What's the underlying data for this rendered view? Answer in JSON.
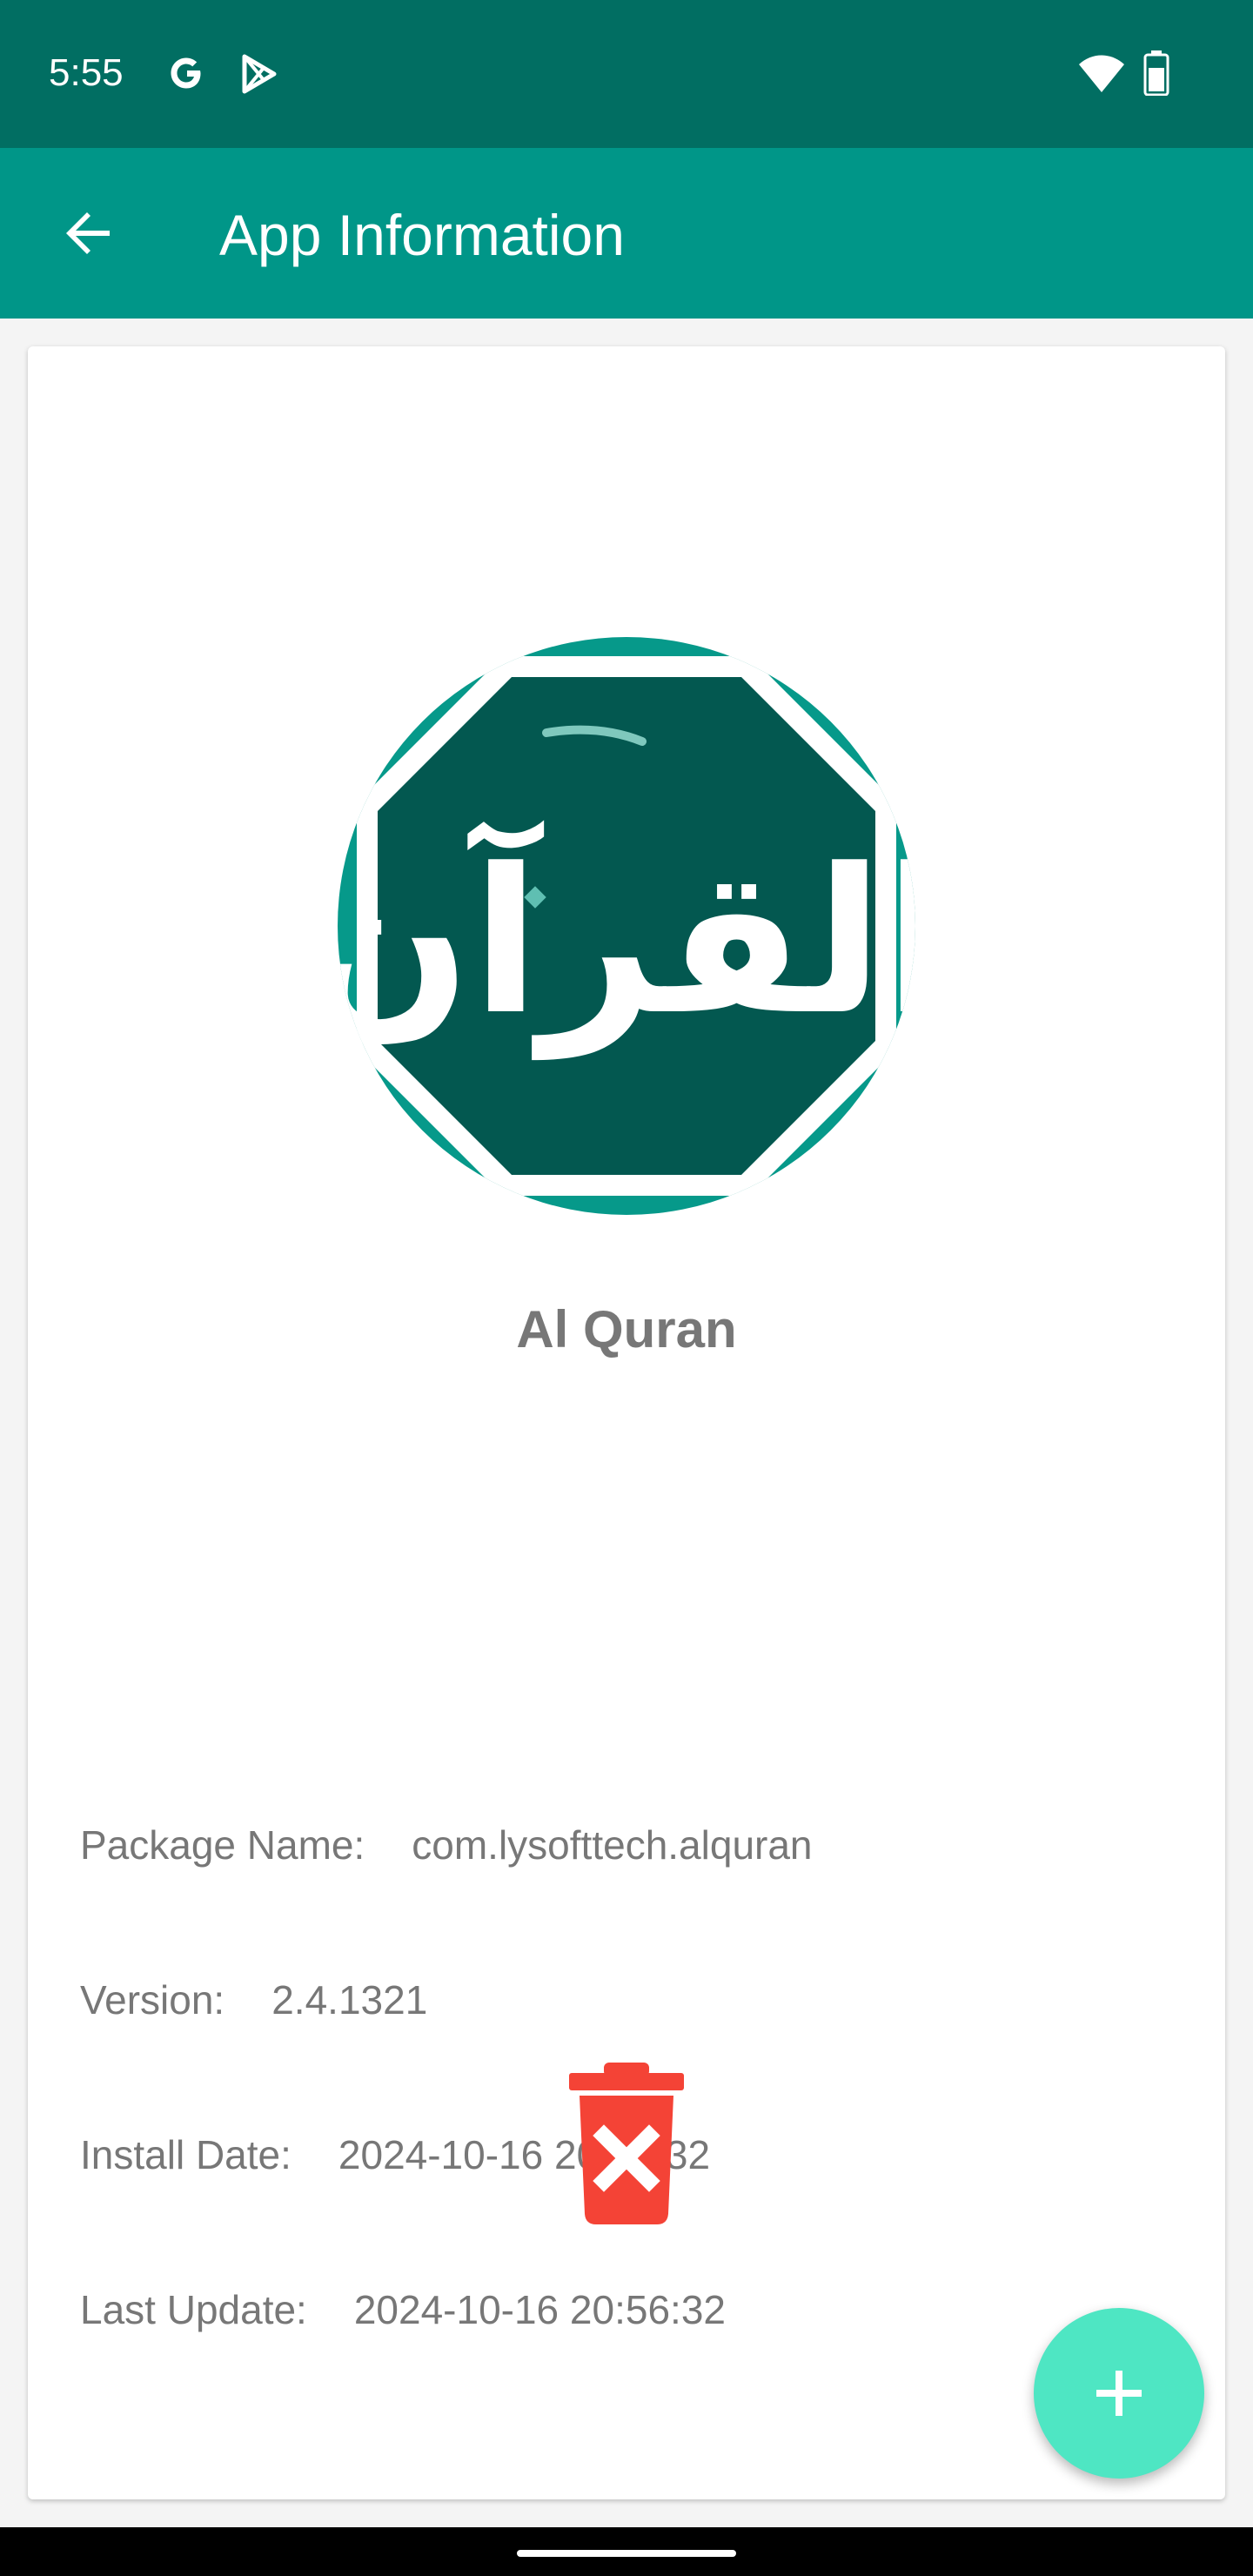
{
  "status_bar": {
    "time": "5:55",
    "left_icons": [
      "google-g-icon",
      "play-store-icon"
    ],
    "right_icons": [
      "wifi-icon",
      "battery-icon"
    ]
  },
  "app_bar": {
    "title": "App Information",
    "back_icon": "arrow-back-icon",
    "background": "#009688"
  },
  "app": {
    "name": "Al Quran",
    "icon": "al-quran-app-icon",
    "icon_text": "القرآن",
    "details": [
      {
        "label": "Package Name:",
        "value": "com.lysofttech.alquran"
      },
      {
        "label": "Version:",
        "value": "2.4.1321"
      },
      {
        "label": "Install Date:",
        "value": "2024-10-16 20:56:32"
      },
      {
        "label": "Last Update:",
        "value": "2024-10-16 20:56:32"
      }
    ]
  },
  "actions": {
    "uninstall_icon": "trash-delete-icon",
    "uninstall_color": "#f44336",
    "fab_icon": "plus-icon",
    "fab_color": "#4ee6c3"
  }
}
